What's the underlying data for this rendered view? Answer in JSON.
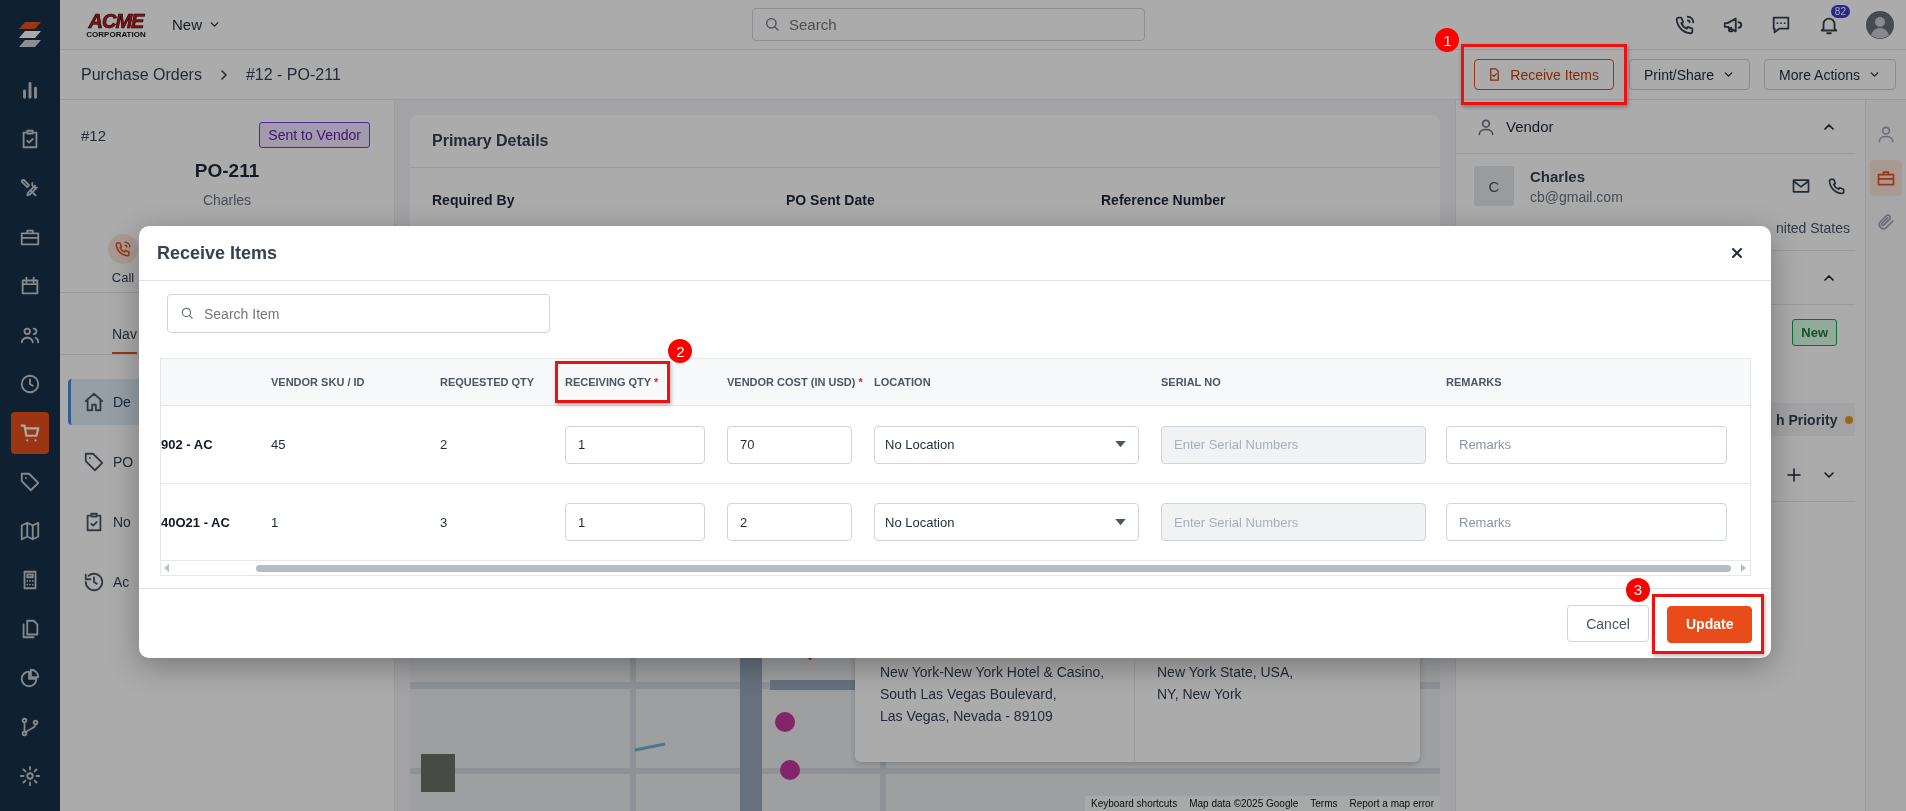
{
  "app_sidebar": {
    "items": [
      {
        "selected": false
      },
      {
        "selected": false
      },
      {
        "selected": false
      },
      {
        "selected": false
      },
      {
        "selected": false
      },
      {
        "selected": false
      },
      {
        "selected": false
      },
      {
        "selected": true
      },
      {
        "selected": false
      },
      {
        "selected": false
      },
      {
        "selected": false
      },
      {
        "selected": false
      },
      {
        "selected": false
      },
      {
        "selected": false
      },
      {
        "selected": false
      }
    ]
  },
  "top_bar": {
    "logo": {
      "text": "ACME",
      "subtext": "CORPORATION"
    },
    "new_menu": "New",
    "search": {
      "placeholder": "Search"
    },
    "notification_count": "82"
  },
  "breadcrumb": [
    "Purchase Orders",
    "#12 - PO-211"
  ],
  "header_actions": [
    {
      "label": "Receive Items",
      "kind": "outline",
      "annotation": {
        "number": "1"
      }
    },
    {
      "label": "Print/Share",
      "kind": "menu"
    },
    {
      "label": "More Actions",
      "kind": "menu"
    }
  ],
  "summary": {
    "number": "#12",
    "status": "Sent to Vendor",
    "title": "PO-211",
    "vendor": "Charles",
    "actions": [
      "Call"
    ]
  },
  "nav_tabs": [
    {
      "label": "Nav",
      "selected": true
    }
  ],
  "nav_items": [
    {
      "label": "De",
      "selected": true
    },
    {
      "label": "PO",
      "selected": false
    },
    {
      "label": "No",
      "selected": false
    },
    {
      "label": "Ac",
      "selected": false
    }
  ],
  "primary_details": {
    "title": "Primary Details",
    "fields": [
      "Required By",
      "PO Sent Date",
      "Reference Number"
    ]
  },
  "map": {
    "kind": "picture",
    "address_lines": [
      "New York-New York Hotel & Casino,",
      "South Las Vegas Boulevard,",
      "Las Vegas, Nevada - 89109"
    ],
    "region_lines": [
      "New York State, USA,",
      "NY, New York"
    ],
    "attribution": [
      "Keyboard shortcuts",
      "Map data ©2025 Google",
      "Terms",
      "Report a map error"
    ]
  },
  "right_panel": {
    "vendor": {
      "title": "Vendor",
      "expanded": true,
      "avatar": "C",
      "name": "Charles",
      "email": "cb@gmail.com",
      "country": "nited States"
    },
    "section_2": {
      "expanded": true,
      "badge": "New",
      "priority": "h Priority"
    },
    "section_3": {
      "expanded": false
    }
  },
  "right_rail": {
    "items": [
      {
        "selected": false
      },
      {
        "selected": true
      },
      {
        "selected": false
      }
    ]
  },
  "modal": {
    "title": "Receive Items",
    "search": {
      "placeholder": "Search Item"
    },
    "columns": [
      {
        "label": "VENDOR SKU / ID"
      },
      {
        "label": "REQUESTED QTY"
      },
      {
        "label": "RECEIVING QTY",
        "required_mark": "*",
        "annotation": {
          "number": "2"
        }
      },
      {
        "label": "VENDOR COST (IN USD)",
        "required_mark": "*"
      },
      {
        "label": "LOCATION"
      },
      {
        "label": "SERIAL NO"
      },
      {
        "label": "REMARKS"
      }
    ],
    "rows": [
      {
        "item": "902 - AC",
        "vendor_sku": "45",
        "requested_qty": "2",
        "receiving_qty": "1",
        "vendor_cost": "70",
        "location": "No Location",
        "serial_placeholder": "Enter Serial Numbers",
        "serial_disabled": true,
        "remarks_placeholder": "Remarks"
      },
      {
        "item": "40O21 - AC",
        "vendor_sku": "1",
        "requested_qty": "3",
        "receiving_qty": "1",
        "vendor_cost": "2",
        "location": "No Location",
        "serial_placeholder": "Enter Serial Numbers",
        "serial_disabled": true,
        "remarks_placeholder": "Remarks"
      }
    ],
    "buttons": [
      {
        "label": "Cancel",
        "kind": "secondary"
      },
      {
        "label": "Update",
        "kind": "primary",
        "annotation": {
          "number": "3"
        }
      }
    ]
  }
}
